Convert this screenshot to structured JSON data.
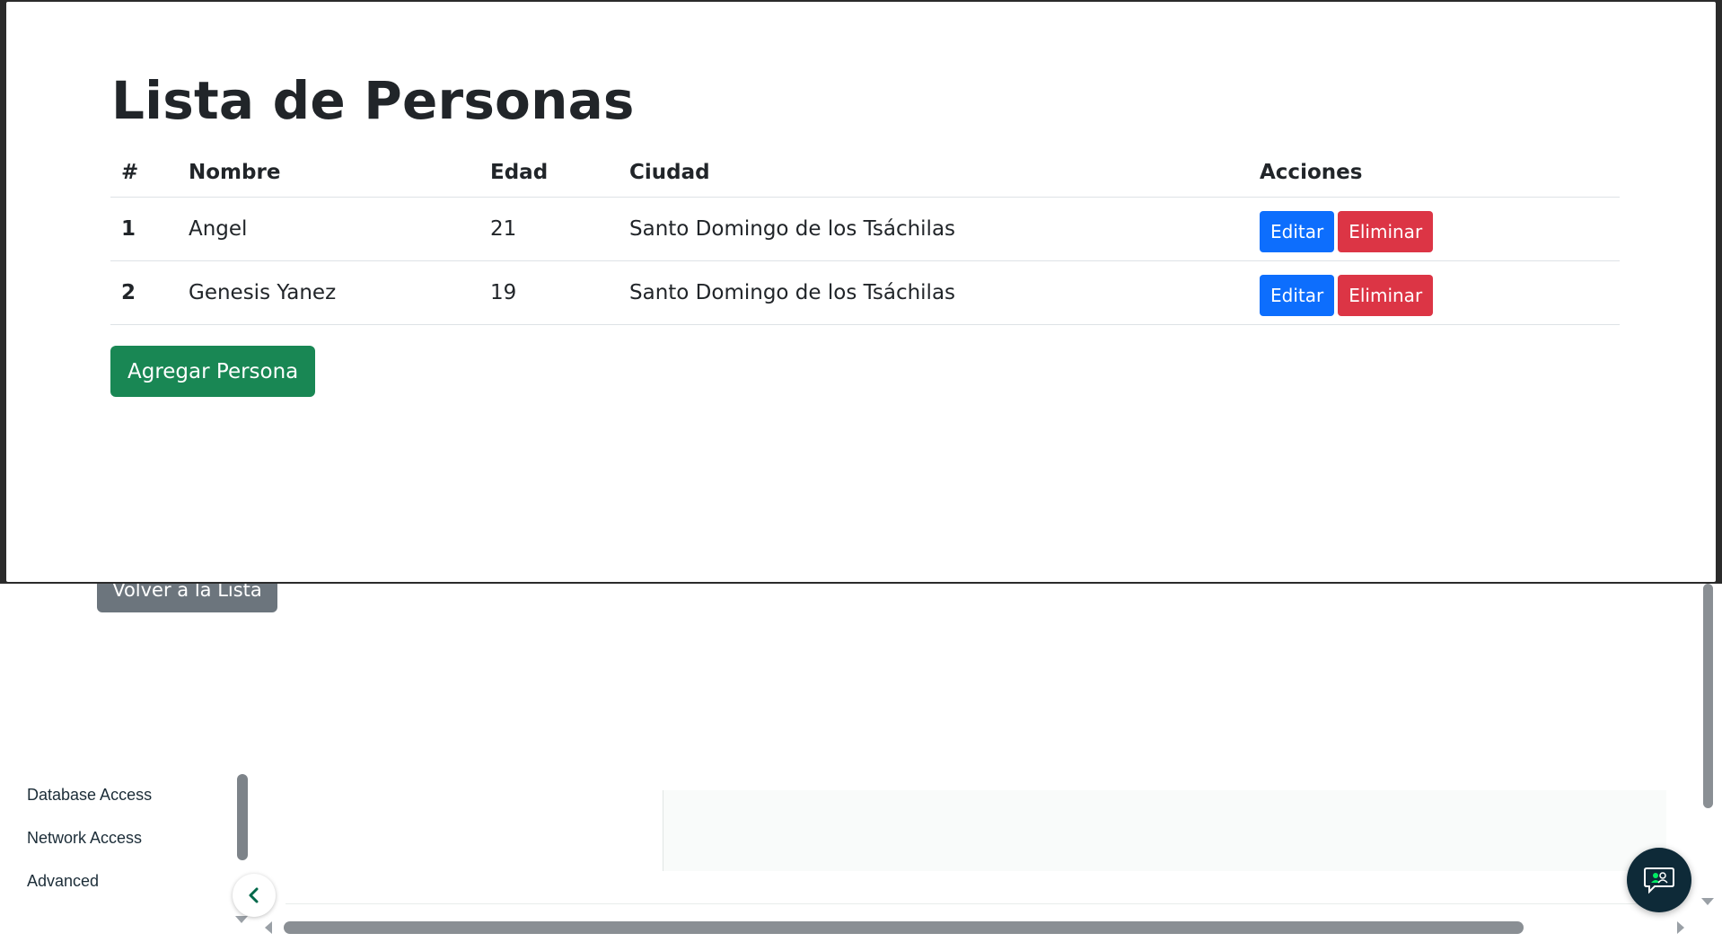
{
  "background": {
    "sidebar": {
      "items": [
        {
          "label": "Database Access"
        },
        {
          "label": "Network Access"
        },
        {
          "label": "Advanced"
        }
      ]
    },
    "volver_button": "Volver a la Lista"
  },
  "app": {
    "title": "Lista de Personas",
    "table": {
      "headers": [
        "#",
        "Nombre",
        "Edad",
        "Ciudad",
        "Acciones"
      ],
      "rows": [
        {
          "num": "1",
          "nombre": "Angel",
          "edad": "21",
          "ciudad": "Santo Domingo de los Tsáchilas",
          "edit": "Editar",
          "delete": "Eliminar"
        },
        {
          "num": "2",
          "nombre": "Genesis Yanez",
          "edad": "19",
          "ciudad": "Santo Domingo de los Tsáchilas",
          "edit": "Editar",
          "delete": "Eliminar"
        }
      ]
    },
    "add_button": "Agregar Persona"
  },
  "icons": {
    "collapse": "chevron-left-icon",
    "chat": "chat-support-icon"
  },
  "colors": {
    "primary": "#0d6efd",
    "danger": "#dc3545",
    "success": "#198754",
    "secondary": "#6c757d",
    "chat": "#0e2a38",
    "collapse_chevron": "#00684a"
  }
}
